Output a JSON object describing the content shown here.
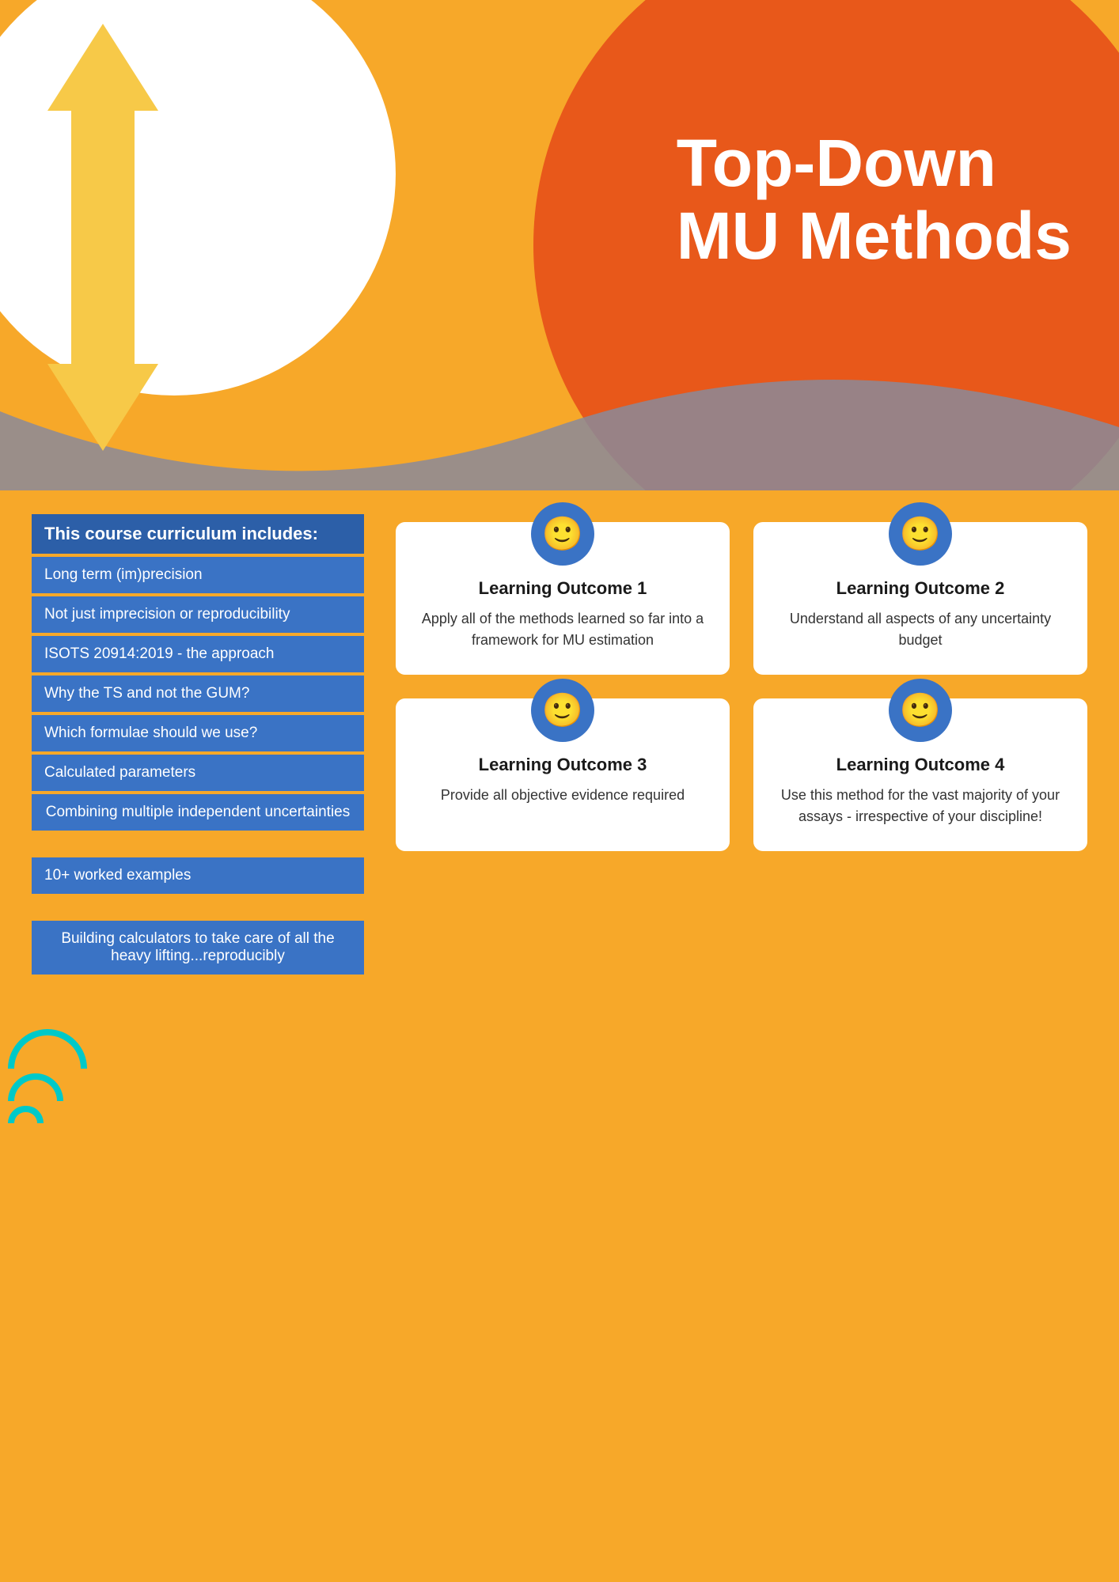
{
  "header": {
    "title_line1": "Top-Down",
    "title_line2": "MU Methods"
  },
  "curriculum": {
    "header_label": "This course curriculum includes:",
    "items": [
      {
        "id": "item-1",
        "text": "Long term (im)precision",
        "multiline": false
      },
      {
        "id": "item-2",
        "text": "Not just imprecision or reproducibility",
        "multiline": false
      },
      {
        "id": "item-3",
        "text": "ISOTS 20914:2019 - the approach",
        "multiline": false
      },
      {
        "id": "item-4",
        "text": "Why the TS and not the GUM?",
        "multiline": false
      },
      {
        "id": "item-5",
        "text": "Which formulae should we use?",
        "multiline": false
      },
      {
        "id": "item-6",
        "text": "Calculated parameters",
        "multiline": false
      },
      {
        "id": "item-7",
        "text": "Combining multiple independent uncertainties",
        "multiline": true
      },
      {
        "id": "item-8",
        "text": "10+ worked examples",
        "multiline": false
      },
      {
        "id": "item-9",
        "text": "Building calculators to take care of all the heavy lifting...reproducibly",
        "multiline": true
      }
    ]
  },
  "outcomes": [
    {
      "id": "outcome-1",
      "title": "Learning Outcome 1",
      "description": "Apply all of the methods learned so far into a framework for MU estimation",
      "icon": "🙂"
    },
    {
      "id": "outcome-2",
      "title": "Learning Outcome 2",
      "description": "Understand all aspects of any uncertainty budget",
      "icon": "🙂"
    },
    {
      "id": "outcome-3",
      "title": "Learning Outcome 3",
      "description": "Provide all objective evidence required",
      "icon": "🙂"
    },
    {
      "id": "outcome-4",
      "title": "Learning Outcome 4",
      "description": "Use this method for the vast majority of your assays - irrespective of your discipline!",
      "icon": "🙂"
    }
  ],
  "icons": {
    "smiley": "🙂"
  }
}
